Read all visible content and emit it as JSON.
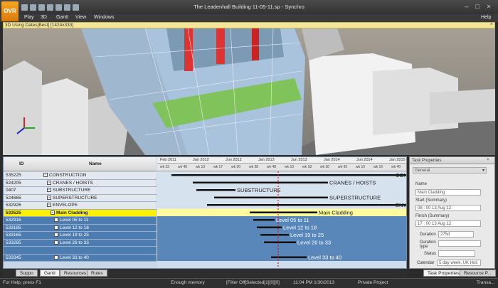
{
  "app": {
    "logo": "OVR",
    "title": "The Leadenhall Building 11-05-11.sp - Synchro",
    "help": "Help"
  },
  "menu": [
    "Play",
    "3D",
    "Gantt",
    "View",
    "Windows"
  ],
  "viewport": {
    "header": "3D Using Dates[Best] [1424x333]",
    "close": "×"
  },
  "gantt": {
    "columns": {
      "id": "ID",
      "name": "Name"
    },
    "years": [
      "Feb 2011",
      "Jan 2012",
      "Jun 2012",
      "Jan 2013",
      "Jun 2013",
      "Jan 2014",
      "Jun 2014",
      "Jan 2015"
    ],
    "weeks": [
      "wk 23",
      "wk 40",
      "wk 10",
      "wk 17",
      "wk 30",
      "wk 38",
      "wk 48",
      "wk 10",
      "wk 18",
      "wk 30",
      "wk 43",
      "wk 10",
      "wk 16",
      "wk 40"
    ],
    "rows": [
      {
        "id": "535225",
        "name": "CONSTRUCTION",
        "indent": 0,
        "style": "plain"
      },
      {
        "id": "524205",
        "name": "CRANES / HOISTS",
        "indent": 1,
        "style": "plain"
      },
      {
        "id": "0407",
        "name": "SUBSTRUCTURE",
        "indent": 1,
        "style": "plain"
      },
      {
        "id": "524665",
        "name": "SUPERSTRUCTURE",
        "indent": 1,
        "style": "plain"
      },
      {
        "id": "532926",
        "name": "ENVELOPE",
        "indent": 1,
        "style": "plain"
      },
      {
        "id": "533525",
        "name": "Main Cladding",
        "indent": 2,
        "style": "selected"
      },
      {
        "id": "532916",
        "name": "Level 05 to 11",
        "indent": 3,
        "style": "blue"
      },
      {
        "id": "533185",
        "name": "Level 12 to 18",
        "indent": 3,
        "style": "blue"
      },
      {
        "id": "533165",
        "name": "Level 19 to 25",
        "indent": 3,
        "style": "blue"
      },
      {
        "id": "533285",
        "name": "Level 26 to 33",
        "indent": 3,
        "style": "blue"
      },
      {
        "id": "",
        "name": "",
        "indent": 3,
        "style": "blue"
      },
      {
        "id": "533345",
        "name": "Level 33 to 40",
        "indent": 3,
        "style": "blue"
      }
    ],
    "bar_labels": [
      "CON",
      "CRANES / HOISTS",
      "SUBSTRUCTURE",
      "SUPERSTRUCTURE",
      "ENVELOP",
      "Main Cladding",
      "Level 05 to 11",
      "Level 12 to 18",
      "Level 19 to 25",
      "Level 26 to 33",
      "Level 33 to 40"
    ]
  },
  "tabs": [
    "Suppo",
    "Gantt",
    "Resources",
    "Rules"
  ],
  "props": {
    "title": "Task Properties",
    "group": "General",
    "name_label": "Name",
    "name_value": "Main Cladding",
    "start_label": "Start (Summary)",
    "start_value": "08 : 00 13 Aug 12",
    "finish_label": "Finish (Summary)",
    "finish_value": "17 : 00 13 Aug 12",
    "duration_label": "Duration",
    "duration_value": "275d",
    "dtype_label": "Duration type",
    "status_label": "Status",
    "calendar_label": "Calendar",
    "calendar_value": "5 day week, UK Holi",
    "tab1": "Task Properties",
    "tab2": "Resource P..."
  },
  "status": {
    "help": "For Help, press F1",
    "memory": "Enough memory",
    "filter": "[Filter Off]",
    "selected": "Selected[1][0][0]",
    "time": "11:04 PM 1/30/2013",
    "project": "Private Project",
    "mode": "Transa..."
  }
}
